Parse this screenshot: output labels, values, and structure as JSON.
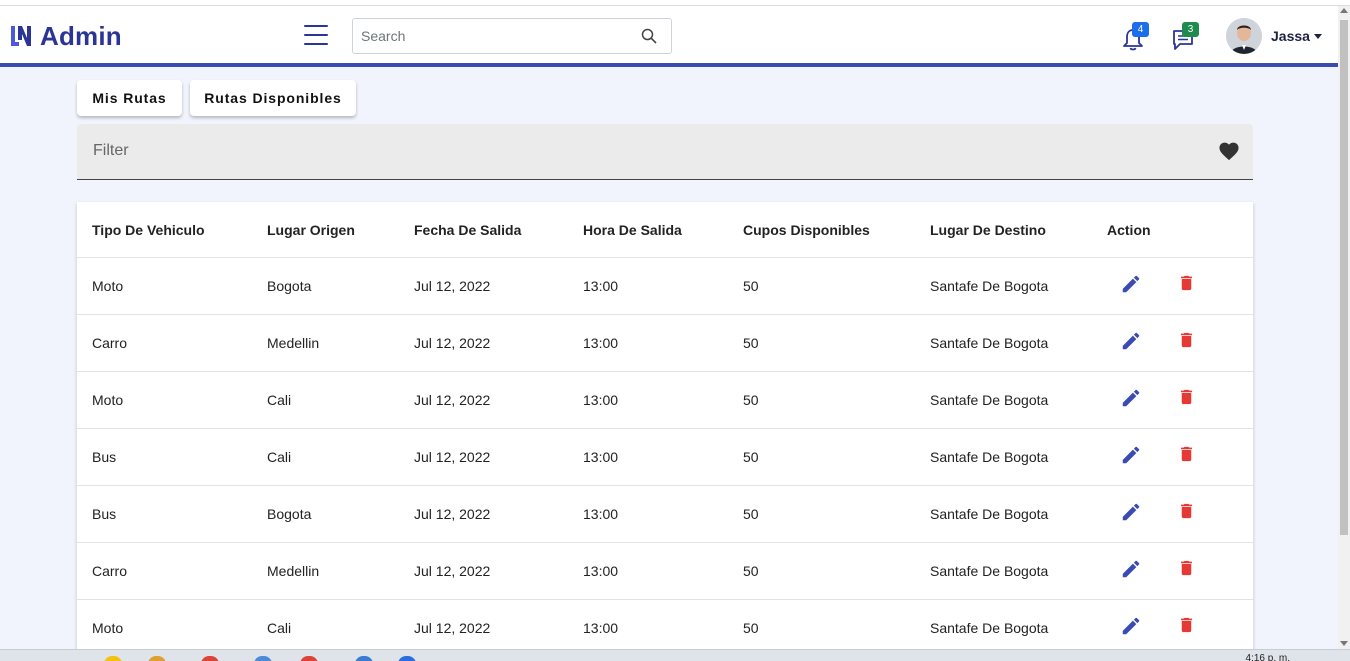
{
  "app": {
    "brand": "Admin",
    "accent_color": "#3a4bb4"
  },
  "header": {
    "search_placeholder": "Search",
    "notifications_count": "4",
    "messages_count": "3",
    "user_name": "Jassa"
  },
  "tabs": [
    {
      "label": "Mis Rutas"
    },
    {
      "label": "Rutas Disponibles"
    }
  ],
  "filter": {
    "placeholder": "Filter"
  },
  "table": {
    "columns": [
      "Tipo De Vehiculo",
      "Lugar Origen",
      "Fecha De Salida",
      "Hora De Salida",
      "Cupos Disponibles",
      "Lugar De Destino",
      "Action"
    ],
    "rows": [
      {
        "tipo": "Moto",
        "origen": "Bogota",
        "fecha": "Jul 12, 2022",
        "hora": "13:00",
        "cupos": "50",
        "destino": "Santafe De Bogota"
      },
      {
        "tipo": "Carro",
        "origen": "Medellin",
        "fecha": "Jul 12, 2022",
        "hora": "13:00",
        "cupos": "50",
        "destino": "Santafe De Bogota"
      },
      {
        "tipo": "Moto",
        "origen": "Cali",
        "fecha": "Jul 12, 2022",
        "hora": "13:00",
        "cupos": "50",
        "destino": "Santafe De Bogota"
      },
      {
        "tipo": "Bus",
        "origen": "Cali",
        "fecha": "Jul 12, 2022",
        "hora": "13:00",
        "cupos": "50",
        "destino": "Santafe De Bogota"
      },
      {
        "tipo": "Bus",
        "origen": "Bogota",
        "fecha": "Jul 12, 2022",
        "hora": "13:00",
        "cupos": "50",
        "destino": "Santafe De Bogota"
      },
      {
        "tipo": "Carro",
        "origen": "Medellin",
        "fecha": "Jul 12, 2022",
        "hora": "13:00",
        "cupos": "50",
        "destino": "Santafe De Bogota"
      },
      {
        "tipo": "Moto",
        "origen": "Cali",
        "fecha": "Jul 12, 2022",
        "hora": "13:00",
        "cupos": "50",
        "destino": "Santafe De Bogota"
      }
    ],
    "icons": {
      "edit": "pencil-icon",
      "delete": "trash-icon"
    },
    "edit_color": "#3a4bb4",
    "delete_color": "#e53935"
  },
  "taskbar": {
    "clock": "4:16 p. m."
  }
}
